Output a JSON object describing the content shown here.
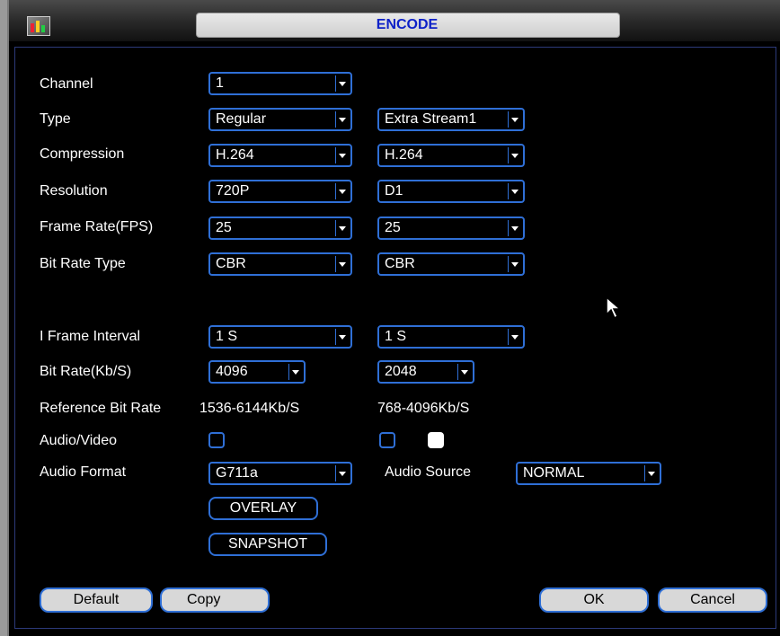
{
  "title": "ENCODE",
  "labels": {
    "channel": "Channel",
    "type": "Type",
    "compression": "Compression",
    "resolution": "Resolution",
    "frame_rate": "Frame Rate(FPS)",
    "bit_rate_type": "Bit Rate Type",
    "i_frame_interval": "I Frame Interval",
    "bit_rate": "Bit Rate(Kb/S)",
    "reference_bit_rate": "Reference Bit Rate",
    "audio_video": "Audio/Video",
    "audio_format": "Audio Format",
    "audio_source": "Audio Source"
  },
  "main": {
    "channel": "1",
    "type": "Regular",
    "compression": "H.264",
    "resolution": "720P",
    "frame_rate": "25",
    "bit_rate_type": "CBR",
    "i_frame_interval": "1 S",
    "bit_rate": "4096",
    "reference_bit_rate": "1536-6144Kb/S",
    "audio_format": "G711a"
  },
  "extra": {
    "type": "Extra Stream1",
    "compression": "H.264",
    "resolution": "D1",
    "frame_rate": "25",
    "bit_rate_type": "CBR",
    "i_frame_interval": "1 S",
    "bit_rate": "2048",
    "reference_bit_rate": "768-4096Kb/S",
    "audio_source": "NORMAL"
  },
  "checkboxes": {
    "main_audio_video": false,
    "extra_audio_video": false,
    "extra_video": true
  },
  "buttons": {
    "overlay": "OVERLAY",
    "snapshot": "SNAPSHOT",
    "default": "Default",
    "copy": "Copy",
    "ok": "OK",
    "cancel": "Cancel"
  },
  "colors": {
    "accent": "#2f6fd6",
    "title_text": "#0d21c8"
  }
}
